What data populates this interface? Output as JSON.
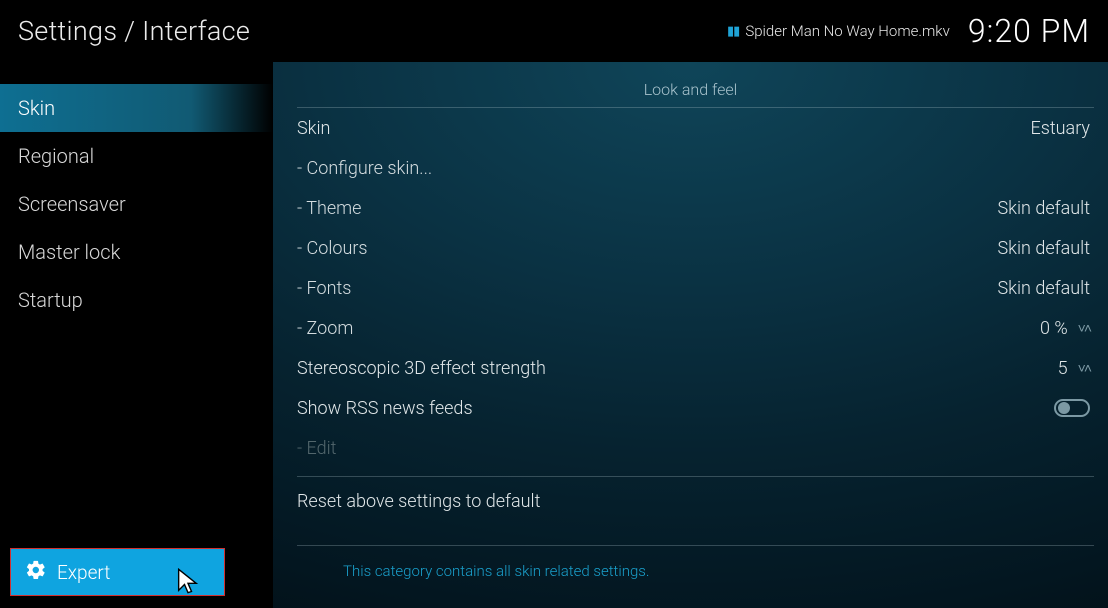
{
  "header": {
    "title": "Settings / Interface",
    "now_playing": "Spider Man No Way Home.mkv",
    "clock": "9:20 PM"
  },
  "sidebar": {
    "items": [
      {
        "label": "Skin",
        "active": true
      },
      {
        "label": "Regional",
        "active": false
      },
      {
        "label": "Screensaver",
        "active": false
      },
      {
        "label": "Master lock",
        "active": false
      },
      {
        "label": "Startup",
        "active": false
      }
    ],
    "level_label": "Expert"
  },
  "section_heading": "Look and feel",
  "settings": {
    "skin_label": "Skin",
    "skin_value": "Estuary",
    "configure_label": "- Configure skin...",
    "theme_label": "- Theme",
    "theme_value": "Skin default",
    "colours_label": "- Colours",
    "colours_value": "Skin default",
    "fonts_label": "- Fonts",
    "fonts_value": "Skin default",
    "zoom_label": "- Zoom",
    "zoom_value": "0 %",
    "stereo_label": "Stereoscopic 3D effect strength",
    "stereo_value": "5",
    "rss_label": "Show RSS news feeds",
    "edit_label": "- Edit",
    "reset_label": "Reset above settings to default"
  },
  "description": "This category contains all skin related settings."
}
